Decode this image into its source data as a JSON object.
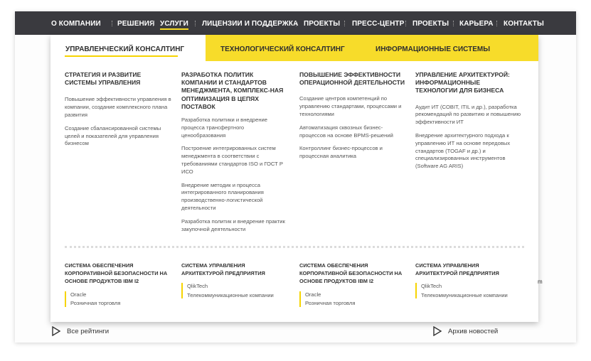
{
  "nav": {
    "items": [
      {
        "label": "О КОМПАНИИ"
      },
      {
        "label": "РЕШЕНИЯ"
      },
      {
        "label": "УСЛУГИ"
      },
      {
        "label": "ЛИЦЕНЗИИ И ПОДДЕРЖКА"
      },
      {
        "label": "ПРОЕКТЫ"
      },
      {
        "label": "ПРЕСС-ЦЕНТР"
      },
      {
        "label": "ПРОЕКТЫ"
      },
      {
        "label": "КАРЬЕРА"
      },
      {
        "label": "КОНТАКТЫ"
      }
    ],
    "active": "УСЛУГИ"
  },
  "tabs": [
    {
      "label": "УПРАВЛЕНЧЕСКИЙ КОНСАЛТИНГ",
      "active": true
    },
    {
      "label": "ТЕХНОЛОГИЧЕСКИЙ КОНСАЛТИНГ",
      "active": false
    },
    {
      "label": "ИНФОРМАЦИОННЫЕ СИСТЕМЫ",
      "active": false
    }
  ],
  "columns": [
    {
      "title": "СТРАТЕГИЯ И РАЗВИТИЕ СИСТЕМЫ УПРАВЛЕНИЯ",
      "links": [
        "Повышение эффективности управления в компании, создание комплексного плана развития",
        "Создание сбалансированной системы целей и показателей для управления бизнесом"
      ]
    },
    {
      "title": "РАЗРАБОТКА ПОЛИТИК КОМПАНИИ И СТАНДАРТОВ МЕНЕДЖМЕНТА, КОМПЛЕКС-НАЯ ОПТИМИЗАЦИЯ В ЦЕПЯХ ПОСТАВОК",
      "links": [
        "Разработка политики и внедрение процесса трансфертного ценообразования",
        "Построение интегрированных систем менеджмента в соответствии с требованиями стандартов ISO и ГОСТ Р ИСО",
        "Внедрение методик и процесса интегрированного планирования производственно-логистической деятельности",
        "Разработка политик и внедрение практик закупочной деятельности"
      ]
    },
    {
      "title": "ПОВЫШЕНИЕ ЭФФЕКТИВНОСТИ ОПЕРАЦИОННОЙ ДЕЯТЕЛЬНОСТИ",
      "links": [
        "Создание центров компетенций по управлению стандартами, процессами и технологиями",
        "Автоматизация сквозных бизнес-процессов на основе BPMS-решений",
        "Контроллинг бизнес-процессов и процессная аналитика"
      ]
    },
    {
      "title": "УПРАВЛЕНИЕ АРХИТЕКТУРОЙ: ИНФОРМАЦИОННЫЕ ТЕХНОЛОГИИ ДЛЯ БИЗНЕСА",
      "links": [
        "Аудит ИТ (COBIT, ITIL и др.), разработка рекомендаций по развитию и повышению эффективности ИТ",
        "Внедрение архитектурного подхода к управлению ИТ на основе передовых стандартов (TOGAF и др.) и специализированных инструментов (Software AG ARIS)"
      ]
    }
  ],
  "bottom_columns": [
    {
      "title": "СИСТЕМА ОБЕСПЕЧЕНИЯ КОРПОРАТИВНОЙ БЕЗОПАСНОСТИ НА ОСНОВЕ ПРОДУКТОВ IBM I2",
      "items": [
        "Oracle",
        "Розничная торговля"
      ]
    },
    {
      "title": "СИСТЕМА УПРАВЛЕНИЯ АРХИТЕКТУРОЙ ПРЕДПРИЯТИЯ",
      "items": [
        "QlikTech",
        "Телекоммуникационные компании"
      ]
    },
    {
      "title": "СИСТЕМА ОБЕСПЕЧЕНИЯ КОРПОРАТИВНОЙ БЕЗОПАСНОСТИ НА ОСНОВЕ ПРОДУКТОВ IBM I2",
      "items": [
        "Oracle",
        "Розничная торговля"
      ]
    },
    {
      "title": "СИСТЕМА УПРАВЛЕНИЯ АРХИТЕКТУРОЙ ПРЕДПРИЯТИЯ",
      "items": [
        "QlikTech",
        "Телекоммуникационные компании"
      ]
    }
  ],
  "footer_links": [
    {
      "label": "Все рейтинги",
      "icon": "play-triangle-icon"
    },
    {
      "label": "Архив новостей",
      "icon": "play-triangle-icon"
    }
  ],
  "stray_text": "m",
  "colors": {
    "nav_bg": "#3a3a3f",
    "accent": "#f7dc2a",
    "text": "#333333"
  }
}
